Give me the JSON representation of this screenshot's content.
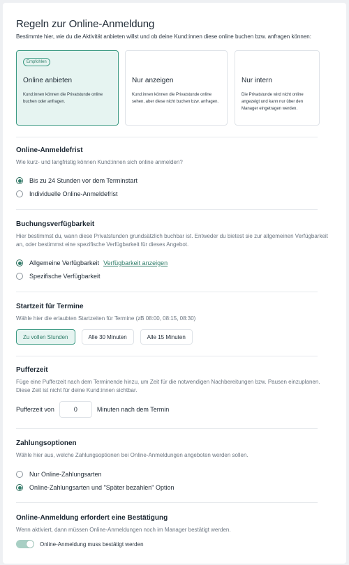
{
  "header": {
    "title": "Regeln zur Online-Anmeldung",
    "subtitle": "Bestimmte hier, wie du die Aktivität anbieten willst und ob deine Kund:innen diese online buchen bzw. anfragen können:"
  },
  "offer_cards": [
    {
      "badge": "Empfohlen",
      "title": "Online anbieten",
      "description": "Kund:innen können die Privatstunde online buchen oder anfragen.",
      "selected": true
    },
    {
      "badge": "",
      "title": "Nur anzeigen",
      "description": "Kund:innen können die Privatstunde online sehen, aber diese nicht buchen bzw. anfragen.",
      "selected": false
    },
    {
      "badge": "",
      "title": "Nur intern",
      "description": "Die Privatstunde wird nicht online angezeigt und kann nur über den Manager eingetragen werden.",
      "selected": false
    }
  ],
  "deadline": {
    "title": "Online-Anmeldefrist",
    "description": "Wie kurz- und langfristig können Kund:innen sich online anmelden?",
    "options": [
      {
        "label": "Bis zu 24 Stunden vor dem Terminstart",
        "selected": true
      },
      {
        "label": "Individuelle Online-Anmeldefrist",
        "selected": false
      }
    ]
  },
  "availability": {
    "title": "Buchungsverfügbarkeit",
    "description": "Hier bestimmst du, wann diese Privatstunden grundsätzlich buchbar ist. Entweder du bietest sie zur allgemeinen Verfügbarkeit an, oder bestimmst eine spezifische Verfügbarkeit für dieses Angebot.",
    "options": [
      {
        "label": "Allgemeine Verfügbarkeit",
        "selected": true
      },
      {
        "label": "Spezifische Verfügbarkeit",
        "selected": false
      }
    ],
    "link_label": "Verfügbarkeit anzeigen"
  },
  "start_time": {
    "title": "Startzeit für Termine",
    "description": "Wähle hier die erlaubten Startzeiten für Termine (zB 08:00, 08:15, 08:30)",
    "options": [
      {
        "label": "Zu vollen Stunden",
        "selected": true
      },
      {
        "label": "Alle 30 Minuten",
        "selected": false
      },
      {
        "label": "Alle 15 Minuten",
        "selected": false
      }
    ]
  },
  "buffer": {
    "title": "Pufferzeit",
    "description": "Füge eine Pufferzeit nach dem Terminende hinzu, um Zeit für die notwendigen Nachbereitungen bzw. Pausen einzuplanen. Diese Zeit ist nicht für deine Kund:innen sichtbar.",
    "prefix": "Pufferzeit von",
    "value": "0",
    "suffix": "Minuten nach dem Termin"
  },
  "payment": {
    "title": "Zahlungsoptionen",
    "description": "Wähle hier aus, welche Zahlungsoptionen bei Online-Anmeldungen angeboten werden sollen.",
    "options": [
      {
        "label": "Nur Online-Zahlungsarten",
        "selected": false
      },
      {
        "label": "Online-Zahlungsarten und \"Später bezahlen\" Option",
        "selected": true
      }
    ]
  },
  "confirmation": {
    "title": "Online-Anmeldung erfordert eine Bestätigung",
    "description": "Wenn aktiviert, dann müssen Online-Anmeldungen noch im Manager bestätigt werden.",
    "toggle_label": "Online-Anmeldung muss bestätigt werden",
    "enabled": true
  },
  "colors": {
    "accent": "#2f7d69",
    "accent_bg": "#e6f4f1",
    "border": "#dfe3e8",
    "muted_text": "#6b7580"
  }
}
